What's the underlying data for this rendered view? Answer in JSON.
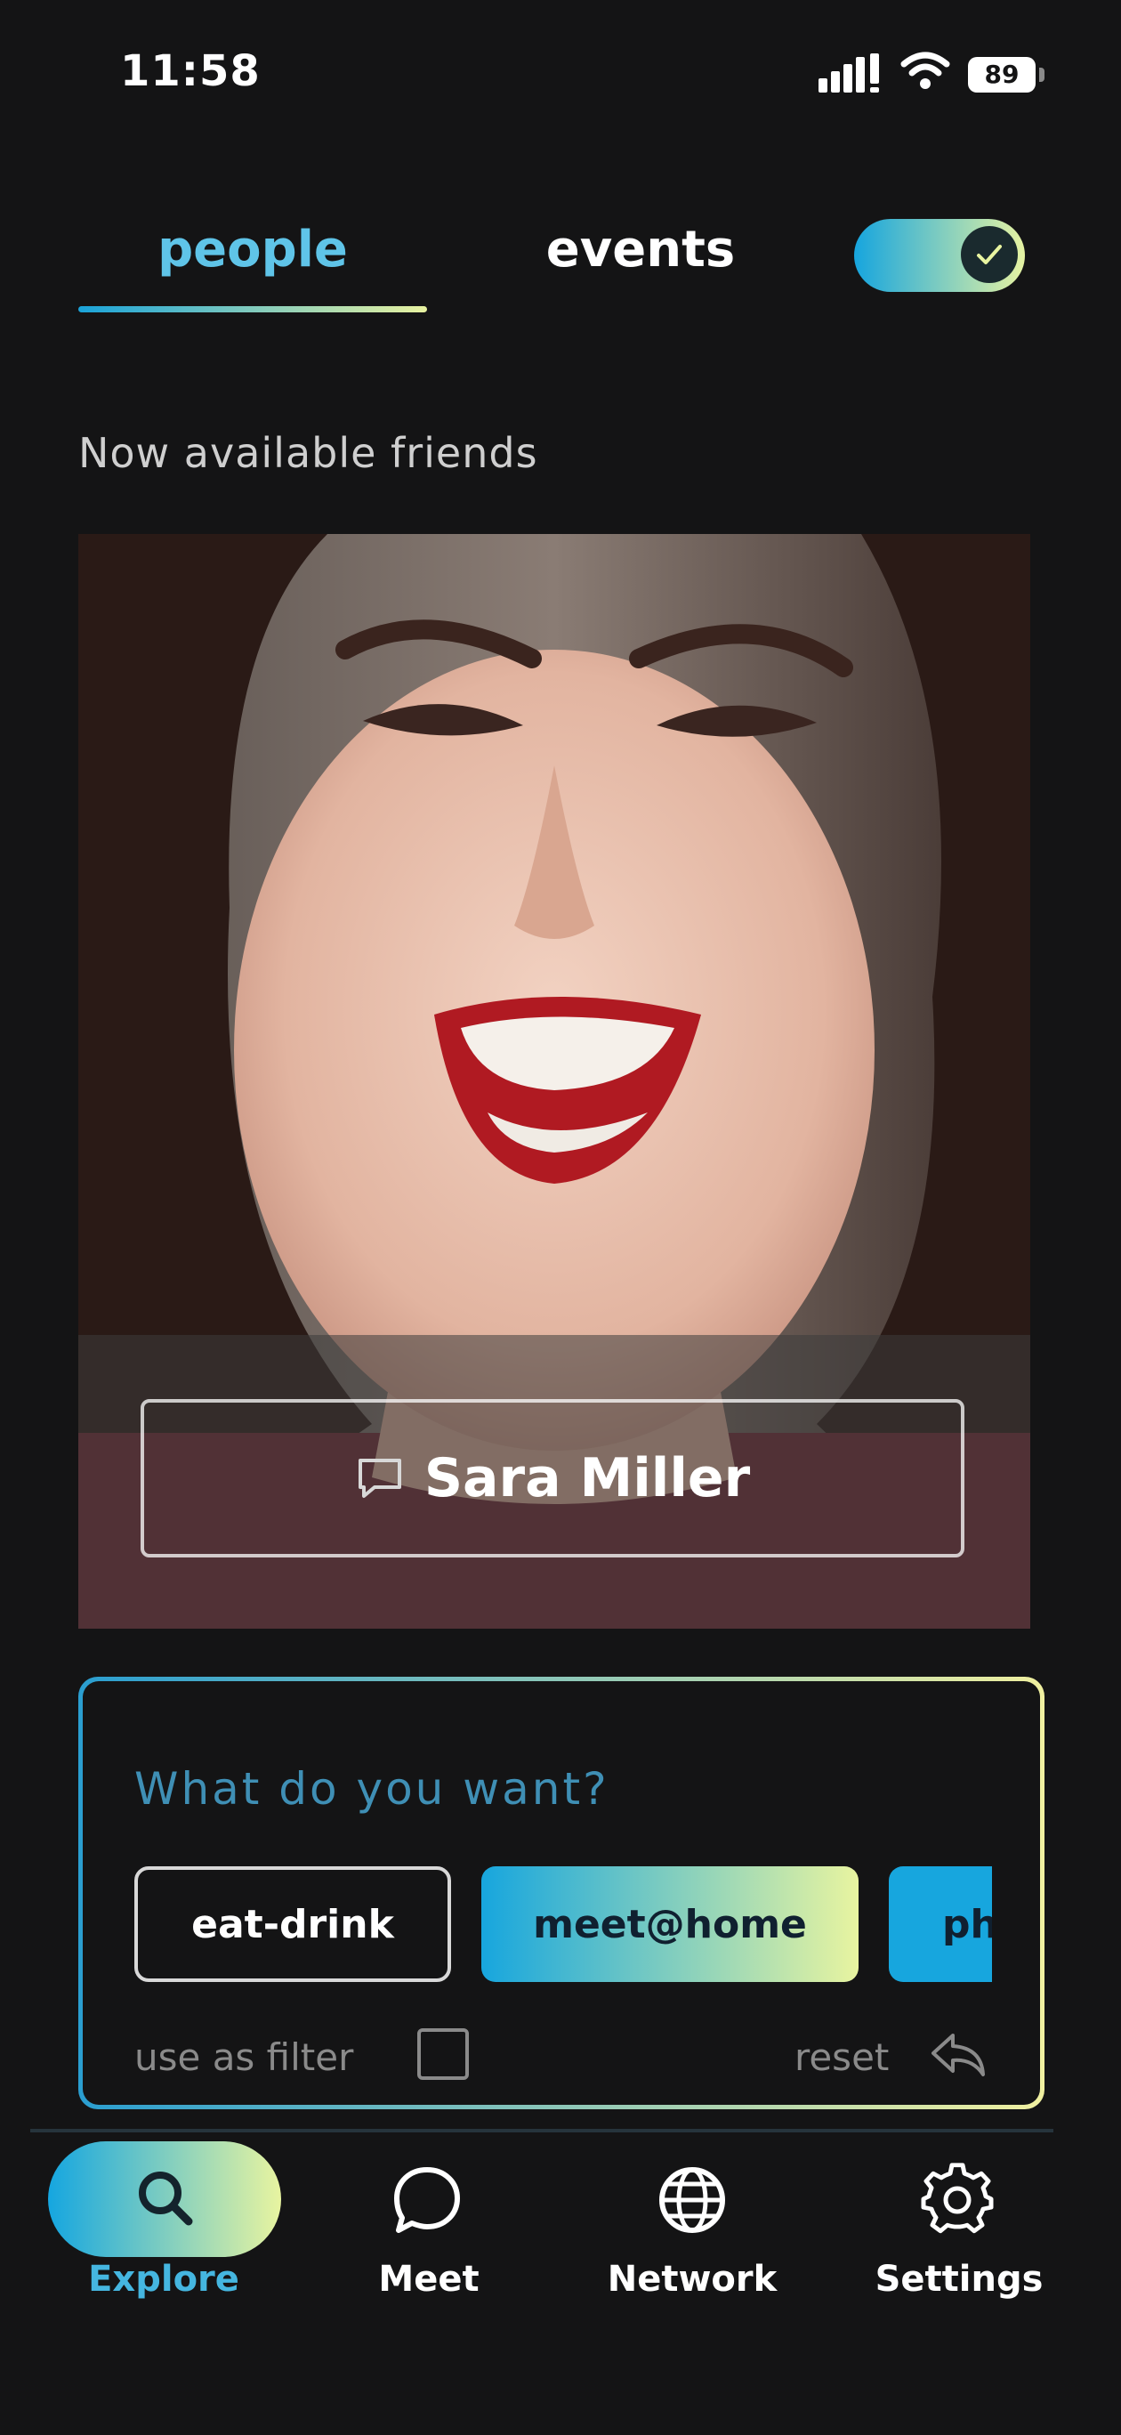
{
  "status_bar": {
    "time": "11:58",
    "battery": "89"
  },
  "tabs": {
    "people": "people",
    "events": "events",
    "active": "people"
  },
  "toggle": {
    "on": true
  },
  "section": {
    "title": "Now available friends"
  },
  "profile": {
    "name": "Sara Miller"
  },
  "preferences": {
    "title": "What do you want?",
    "chips": [
      {
        "label": "eat-drink",
        "selected": false
      },
      {
        "label": "meet@home",
        "selected": true
      },
      {
        "label": "ph",
        "selected": true
      }
    ],
    "filter_label": "use as filter",
    "filter_checked": false,
    "reset_label": "reset"
  },
  "nav": {
    "items": [
      {
        "label": "Explore",
        "icon": "search-icon",
        "active": true
      },
      {
        "label": "Meet",
        "icon": "chat-bubble-icon",
        "active": false
      },
      {
        "label": "Network",
        "icon": "globe-icon",
        "active": false
      },
      {
        "label": "Settings",
        "icon": "gear-icon",
        "active": false
      }
    ]
  },
  "colors": {
    "background": "#141415",
    "accent_start": "#17a6de",
    "accent_end": "#e8f4a0",
    "active_tab": "#5fc4e8"
  }
}
